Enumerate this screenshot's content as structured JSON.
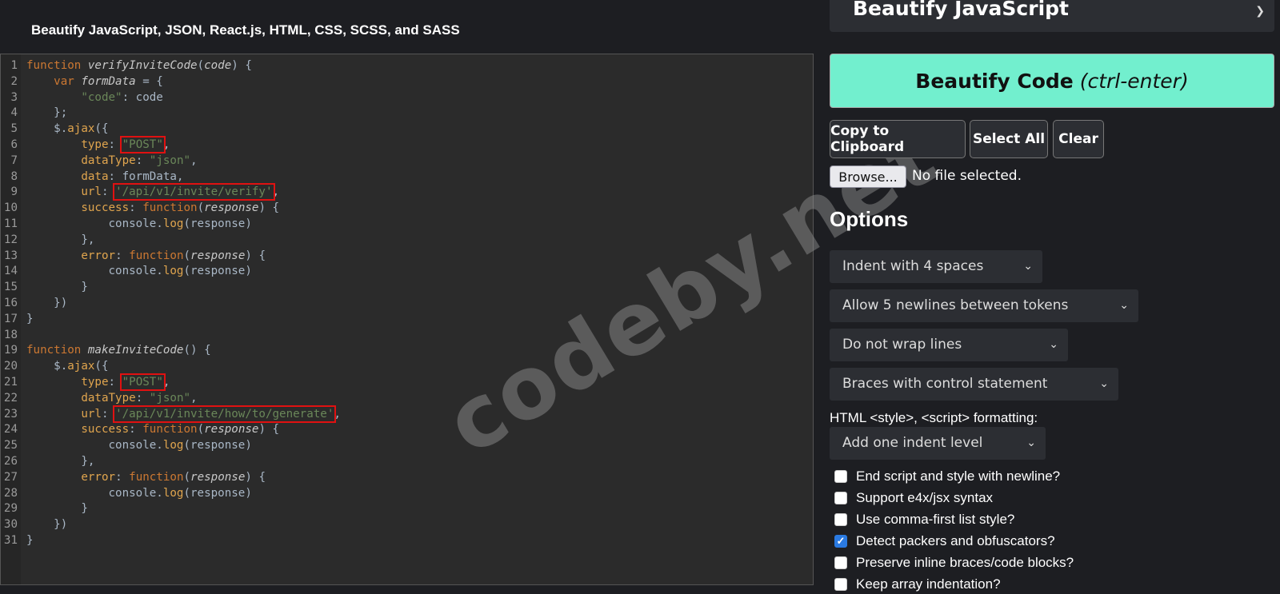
{
  "site_title": "Beautify JavaScript, JSON, React.js, HTML, CSS, SCSS, and SASS",
  "watermark": "codeby.net",
  "language_select": "Beautify JavaScript",
  "actions": {
    "beautify_label": "Beautify Code",
    "beautify_shortcut": "(ctrl-enter)",
    "copy_label": "Copy to Clipboard",
    "select_all_label": "Select All",
    "clear_label": "Clear",
    "browse_label": "Browse...",
    "no_file_label": "No file selected."
  },
  "options": {
    "heading": "Options",
    "indent": "Indent with 4 spaces",
    "newlines": "Allow 5 newlines between tokens",
    "wrap": "Do not wrap lines",
    "braces": "Braces with control statement",
    "format_label": "HTML <style>, <script> formatting:",
    "format_value": "Add one indent level",
    "checkboxes": [
      {
        "label": "End script and style with newline?",
        "checked": false
      },
      {
        "label": "Support e4x/jsx syntax",
        "checked": false
      },
      {
        "label": "Use comma-first list style?",
        "checked": false
      },
      {
        "label": "Detect packers and obfuscators?",
        "checked": true
      },
      {
        "label": "Preserve inline braces/code blocks?",
        "checked": false
      },
      {
        "label": "Keep array indentation?",
        "checked": false
      }
    ]
  },
  "code_lines": [
    [
      [
        "kw",
        "function "
      ],
      [
        "fn",
        "verifyInviteCode"
      ],
      [
        "p",
        "("
      ],
      [
        "var",
        "code"
      ],
      [
        "p",
        ") {"
      ]
    ],
    [
      [
        "p",
        "    "
      ],
      [
        "kw",
        "var "
      ],
      [
        "var",
        "formData"
      ],
      [
        "p",
        " = {"
      ]
    ],
    [
      [
        "p",
        "        "
      ],
      [
        "str",
        "\"code\""
      ],
      [
        "p",
        ": code"
      ]
    ],
    [
      [
        "p",
        "    };"
      ]
    ],
    [
      [
        "p",
        "    $."
      ],
      [
        "mth",
        "ajax"
      ],
      [
        "p",
        "({"
      ]
    ],
    [
      [
        "p",
        "        "
      ],
      [
        "prop",
        "type"
      ],
      [
        "p",
        ": "
      ],
      [
        "hl",
        "\"POST\""
      ],
      [
        "p",
        ","
      ]
    ],
    [
      [
        "p",
        "        "
      ],
      [
        "prop",
        "dataType"
      ],
      [
        "p",
        ": "
      ],
      [
        "str",
        "\"json\""
      ],
      [
        "p",
        ","
      ]
    ],
    [
      [
        "p",
        "        "
      ],
      [
        "prop",
        "data"
      ],
      [
        "p",
        ": formData,"
      ]
    ],
    [
      [
        "p",
        "        "
      ],
      [
        "prop",
        "url"
      ],
      [
        "p",
        ": "
      ],
      [
        "hl",
        "'/api/v1/invite/verify'"
      ],
      [
        "p",
        ","
      ]
    ],
    [
      [
        "p",
        "        "
      ],
      [
        "prop",
        "success"
      ],
      [
        "p",
        ": "
      ],
      [
        "kw",
        "function"
      ],
      [
        "p",
        "("
      ],
      [
        "var",
        "response"
      ],
      [
        "p",
        ") {"
      ]
    ],
    [
      [
        "p",
        "            console."
      ],
      [
        "mth",
        "log"
      ],
      [
        "p",
        "(response)"
      ]
    ],
    [
      [
        "p",
        "        },"
      ]
    ],
    [
      [
        "p",
        "        "
      ],
      [
        "prop",
        "error"
      ],
      [
        "p",
        ": "
      ],
      [
        "kw",
        "function"
      ],
      [
        "p",
        "("
      ],
      [
        "var",
        "response"
      ],
      [
        "p",
        ") {"
      ]
    ],
    [
      [
        "p",
        "            console."
      ],
      [
        "mth",
        "log"
      ],
      [
        "p",
        "(response)"
      ]
    ],
    [
      [
        "p",
        "        }"
      ]
    ],
    [
      [
        "p",
        "    })"
      ]
    ],
    [
      [
        "p",
        "}"
      ]
    ],
    [
      [
        "p",
        ""
      ]
    ],
    [
      [
        "kw",
        "function "
      ],
      [
        "fn",
        "makeInviteCode"
      ],
      [
        "p",
        "() {"
      ]
    ],
    [
      [
        "p",
        "    $."
      ],
      [
        "mth",
        "ajax"
      ],
      [
        "p",
        "({"
      ]
    ],
    [
      [
        "p",
        "        "
      ],
      [
        "prop",
        "type"
      ],
      [
        "p",
        ": "
      ],
      [
        "hl",
        "\"POST\""
      ],
      [
        "p",
        ","
      ]
    ],
    [
      [
        "p",
        "        "
      ],
      [
        "prop",
        "dataType"
      ],
      [
        "p",
        ": "
      ],
      [
        "str",
        "\"json\""
      ],
      [
        "p",
        ","
      ]
    ],
    [
      [
        "p",
        "        "
      ],
      [
        "prop",
        "url"
      ],
      [
        "p",
        ": "
      ],
      [
        "hl",
        "'/api/v1/invite/how/to/generate'"
      ],
      [
        "p",
        ","
      ]
    ],
    [
      [
        "p",
        "        "
      ],
      [
        "prop",
        "success"
      ],
      [
        "p",
        ": "
      ],
      [
        "kw",
        "function"
      ],
      [
        "p",
        "("
      ],
      [
        "var",
        "response"
      ],
      [
        "p",
        ") {"
      ]
    ],
    [
      [
        "p",
        "            console."
      ],
      [
        "mth",
        "log"
      ],
      [
        "p",
        "(response)"
      ]
    ],
    [
      [
        "p",
        "        },"
      ]
    ],
    [
      [
        "p",
        "        "
      ],
      [
        "prop",
        "error"
      ],
      [
        "p",
        ": "
      ],
      [
        "kw",
        "function"
      ],
      [
        "p",
        "("
      ],
      [
        "var",
        "response"
      ],
      [
        "p",
        ") {"
      ]
    ],
    [
      [
        "p",
        "            console."
      ],
      [
        "mth",
        "log"
      ],
      [
        "p",
        "(response)"
      ]
    ],
    [
      [
        "p",
        "        }"
      ]
    ],
    [
      [
        "p",
        "    })"
      ]
    ],
    [
      [
        "p",
        "}"
      ]
    ]
  ]
}
